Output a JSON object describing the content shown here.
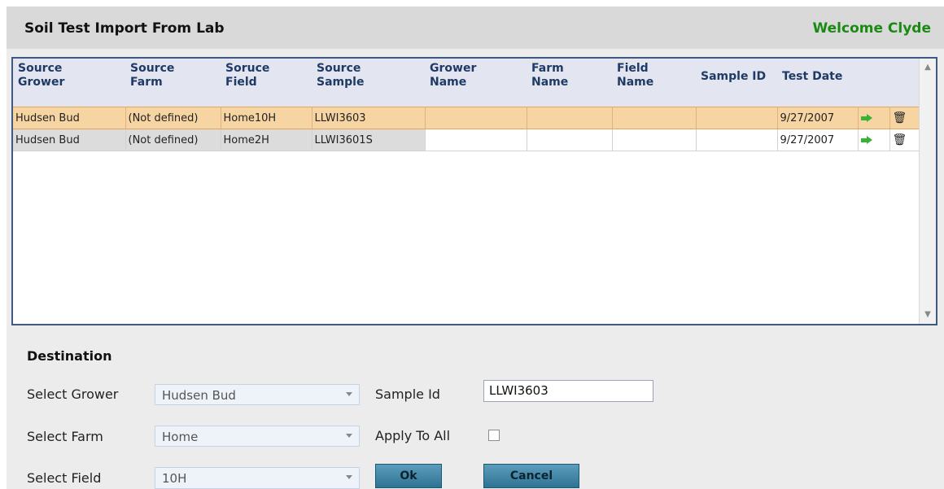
{
  "header": {
    "title": "Soil Test Import From Lab",
    "welcome": "Welcome Clyde"
  },
  "grid": {
    "columns": [
      {
        "line1": "Source",
        "line2": "Grower"
      },
      {
        "line1": "Source",
        "line2": "Farm"
      },
      {
        "line1": "Soruce",
        "line2": "Field"
      },
      {
        "line1": "Source",
        "line2": "Sample"
      },
      {
        "line1": "Grower",
        "line2": "Name"
      },
      {
        "line1": "Farm",
        "line2": "Name"
      },
      {
        "line1": "Field",
        "line2": "Name"
      },
      {
        "line1": "Sample ID",
        "line2": ""
      },
      {
        "line1": "Test Date",
        "line2": ""
      }
    ],
    "rows": [
      {
        "source_grower": "Hudsen Bud",
        "source_farm": "(Not defined)",
        "source_field": "Home10H",
        "source_sample": "LLWI3603",
        "grower_name": "",
        "farm_name": "",
        "field_name": "",
        "sample_id": "",
        "test_date": "9/27/2007",
        "selected": true
      },
      {
        "source_grower": "Hudsen Bud",
        "source_farm": "(Not defined)",
        "source_field": "Home2H",
        "source_sample": "LLWI3601S",
        "grower_name": "",
        "farm_name": "",
        "field_name": "",
        "sample_id": "",
        "test_date": "9/27/2007",
        "selected": false
      }
    ],
    "icons": {
      "row_action": "green-arrow-icon",
      "row_delete": "trash-can-icon"
    }
  },
  "destination": {
    "title": "Destination",
    "grower_label": "Select Grower",
    "grower_value": "Hudsen Bud",
    "farm_label": "Select Farm",
    "farm_value": "Home",
    "field_label": "Select Field",
    "field_value": "10H",
    "sample_id_label": "Sample Id",
    "sample_id_value": "LLWI3603",
    "apply_all_label": "Apply To All",
    "apply_all_checked": false,
    "ok_label": "Ok",
    "cancel_label": "Cancel"
  },
  "colors": {
    "header_bg": "#d9d9d9",
    "welcome": "#1a8a12",
    "grid_border": "#3f5a7e",
    "selected_row": "#f6d5a3",
    "button": "#3a84a7"
  }
}
